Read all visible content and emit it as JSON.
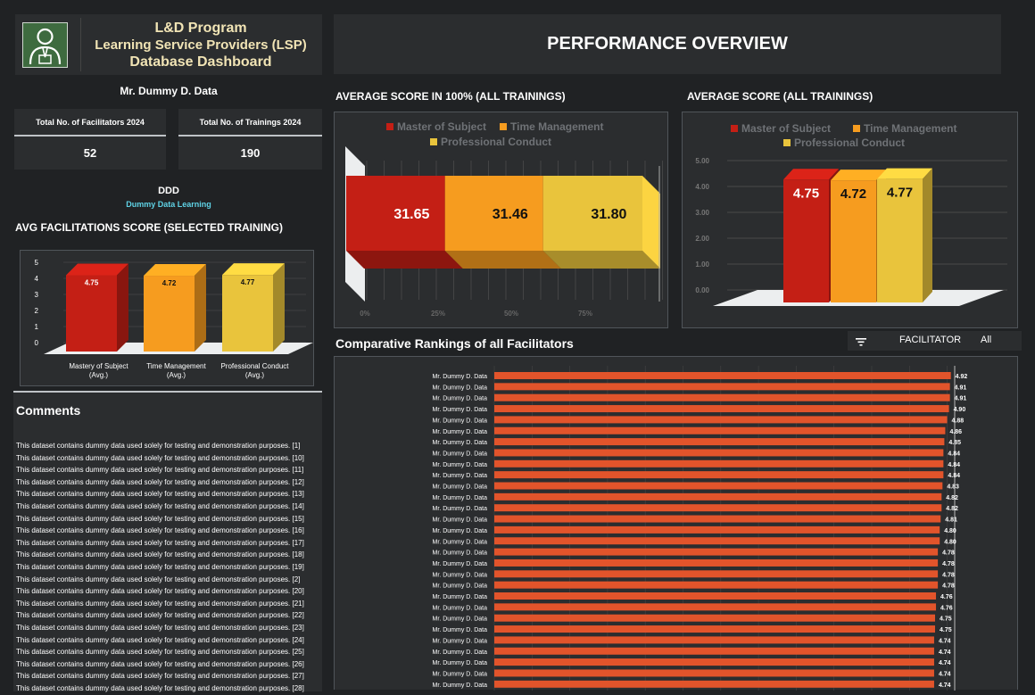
{
  "header": {
    "line1": "L&D Program",
    "line2": "Learning Service Providers (LSP)",
    "line3": "Database Dashboard",
    "logo_icon": "person-icon",
    "page_title": "PERFORMANCE OVERVIEW"
  },
  "user": {
    "name": "Mr. Dummy D. Data"
  },
  "kpis": {
    "facilitators_label": "Total No. of Facilitators 2024",
    "facilitators_value": "52",
    "trainings_label": "Total No. of Trainings 2024",
    "trainings_value": "190"
  },
  "org": {
    "code": "DDD",
    "name": "Dummy Data Learning"
  },
  "sections": {
    "avg_facilitation": "AVG FACILITATIONS SCORE (SELECTED TRAINING)",
    "avg_100": "AVERAGE SCORE IN 100% (ALL TRAININGS)",
    "avg_all": "AVERAGE SCORE (ALL TRAININGS)",
    "rankings": "Comparative Rankings of all Facilitators",
    "comments": "Comments"
  },
  "filter": {
    "icon": "filter-icon",
    "label": "FACILITATOR",
    "value": "All"
  },
  "colors": {
    "red": "#c41f15",
    "orange": "#f69c1f",
    "yellow": "#e9c43c",
    "rank_bar": "#e2542b",
    "background": "#202224",
    "panel": "#2b2d2f"
  },
  "chart_data": [
    {
      "type": "bar",
      "title": "AVG FACILITATIONS SCORE (SELECTED TRAINING)",
      "categories": [
        "Mastery of Subject (Avg.)",
        "Time Management (Avg.)",
        "Professional Conduct (Avg.)"
      ],
      "values": [
        4.75,
        4.72,
        4.77
      ],
      "value_labels": [
        "4.75",
        "4.72",
        "4.77"
      ],
      "ylim": [
        0,
        5
      ],
      "yticks": [
        "0",
        "1",
        "2",
        "3",
        "4",
        "5"
      ]
    },
    {
      "type": "bar",
      "orientation": "horizontal-stacked",
      "title": "AVERAGE SCORE IN 100% (ALL TRAININGS)",
      "series": [
        {
          "name": "Master of Subject",
          "values": [
            31.65
          ],
          "label": "31.65",
          "color": "#c41f15"
        },
        {
          "name": "Time Management",
          "values": [
            31.46
          ],
          "label": "31.46",
          "color": "#f69c1f"
        },
        {
          "name": "Professional Conduct",
          "values": [
            31.8
          ],
          "label": "31.80",
          "color": "#e9c43c"
        }
      ],
      "xticks": [
        "0%",
        "25%",
        "50%",
        "75%"
      ],
      "legend": "top"
    },
    {
      "type": "bar",
      "title": "AVERAGE SCORE (ALL TRAININGS)",
      "series": [
        {
          "name": "Master of Subject",
          "values": [
            4.75
          ],
          "label": "4.75",
          "color": "#c41f15"
        },
        {
          "name": "Time Management",
          "values": [
            4.72
          ],
          "label": "4.72",
          "color": "#f69c1f"
        },
        {
          "name": "Professional Conduct",
          "values": [
            4.77
          ],
          "label": "4.77",
          "color": "#e9c43c"
        }
      ],
      "ylim": [
        0,
        5
      ],
      "yticks": [
        "0.00",
        "1.00",
        "2.00",
        "3.00",
        "4.00",
        "5.00"
      ],
      "legend": "top"
    },
    {
      "type": "bar",
      "orientation": "horizontal",
      "title": "Comparative Rankings of all Facilitators",
      "categories": [
        "Mr. Dummy D. Data",
        "Mr. Dummy D. Data",
        "Mr. Dummy D. Data",
        "Mr. Dummy D. Data",
        "Mr. Dummy D. Data",
        "Mr. Dummy D. Data",
        "Mr. Dummy D. Data",
        "Mr. Dummy D. Data",
        "Mr. Dummy D. Data",
        "Mr. Dummy D. Data",
        "Mr. Dummy D. Data",
        "Mr. Dummy D. Data",
        "Mr. Dummy D. Data",
        "Mr. Dummy D. Data",
        "Mr. Dummy D. Data",
        "Mr. Dummy D. Data",
        "Mr. Dummy D. Data",
        "Mr. Dummy D. Data",
        "Mr. Dummy D. Data",
        "Mr. Dummy D. Data",
        "Mr. Dummy D. Data",
        "Mr. Dummy D. Data",
        "Mr. Dummy D. Data",
        "Mr. Dummy D. Data",
        "Mr. Dummy D. Data",
        "Mr. Dummy D. Data",
        "Mr. Dummy D. Data",
        "Mr. Dummy D. Data",
        "Mr. Dummy D. Data"
      ],
      "values": [
        4.92,
        4.91,
        4.91,
        4.9,
        4.88,
        4.86,
        4.85,
        4.84,
        4.84,
        4.84,
        4.83,
        4.82,
        4.82,
        4.81,
        4.8,
        4.8,
        4.78,
        4.78,
        4.78,
        4.78,
        4.76,
        4.76,
        4.75,
        4.75,
        4.74,
        4.74,
        4.74,
        4.74,
        4.74
      ],
      "value_labels": [
        "4.92",
        "4.91",
        "4.91",
        "4.90",
        "4.88",
        "4.86",
        "4.85",
        "4.84",
        "4.84",
        "4.84",
        "4.83",
        "4.82",
        "4.82",
        "4.81",
        "4.80",
        "4.80",
        "4.78",
        "4.78",
        "4.78",
        "4.78",
        "4.76",
        "4.76",
        "4.75",
        "4.75",
        "4.74",
        "4.74",
        "4.74",
        "4.74",
        "4.74"
      ]
    }
  ],
  "comments": [
    "This dataset contains dummy data used solely for testing and demonstration purposes. [1]",
    "This dataset contains dummy data used solely for testing and demonstration purposes. [10]",
    "This dataset contains dummy data used solely for testing and demonstration purposes. [11]",
    "This dataset contains dummy data used solely for testing and demonstration purposes. [12]",
    "This dataset contains dummy data used solely for testing and demonstration purposes. [13]",
    "This dataset contains dummy data used solely for testing and demonstration purposes. [14]",
    "This dataset contains dummy data used solely for testing and demonstration purposes. [15]",
    "This dataset contains dummy data used solely for testing and demonstration purposes. [16]",
    "This dataset contains dummy data used solely for testing and demonstration purposes. [17]",
    "This dataset contains dummy data used solely for testing and demonstration purposes. [18]",
    "This dataset contains dummy data used solely for testing and demonstration purposes. [19]",
    "This dataset contains dummy data used solely for testing and demonstration purposes. [2]",
    "This dataset contains dummy data used solely for testing and demonstration purposes. [20]",
    "This dataset contains dummy data used solely for testing and demonstration purposes. [21]",
    "This dataset contains dummy data used solely for testing and demonstration purposes. [22]",
    "This dataset contains dummy data used solely for testing and demonstration purposes. [23]",
    "This dataset contains dummy data used solely for testing and demonstration purposes. [24]",
    "This dataset contains dummy data used solely for testing and demonstration purposes. [25]",
    "This dataset contains dummy data used solely for testing and demonstration purposes. [26]",
    "This dataset contains dummy data used solely for testing and demonstration purposes. [27]",
    "This dataset contains dummy data used solely for testing and demonstration purposes. [28]"
  ]
}
